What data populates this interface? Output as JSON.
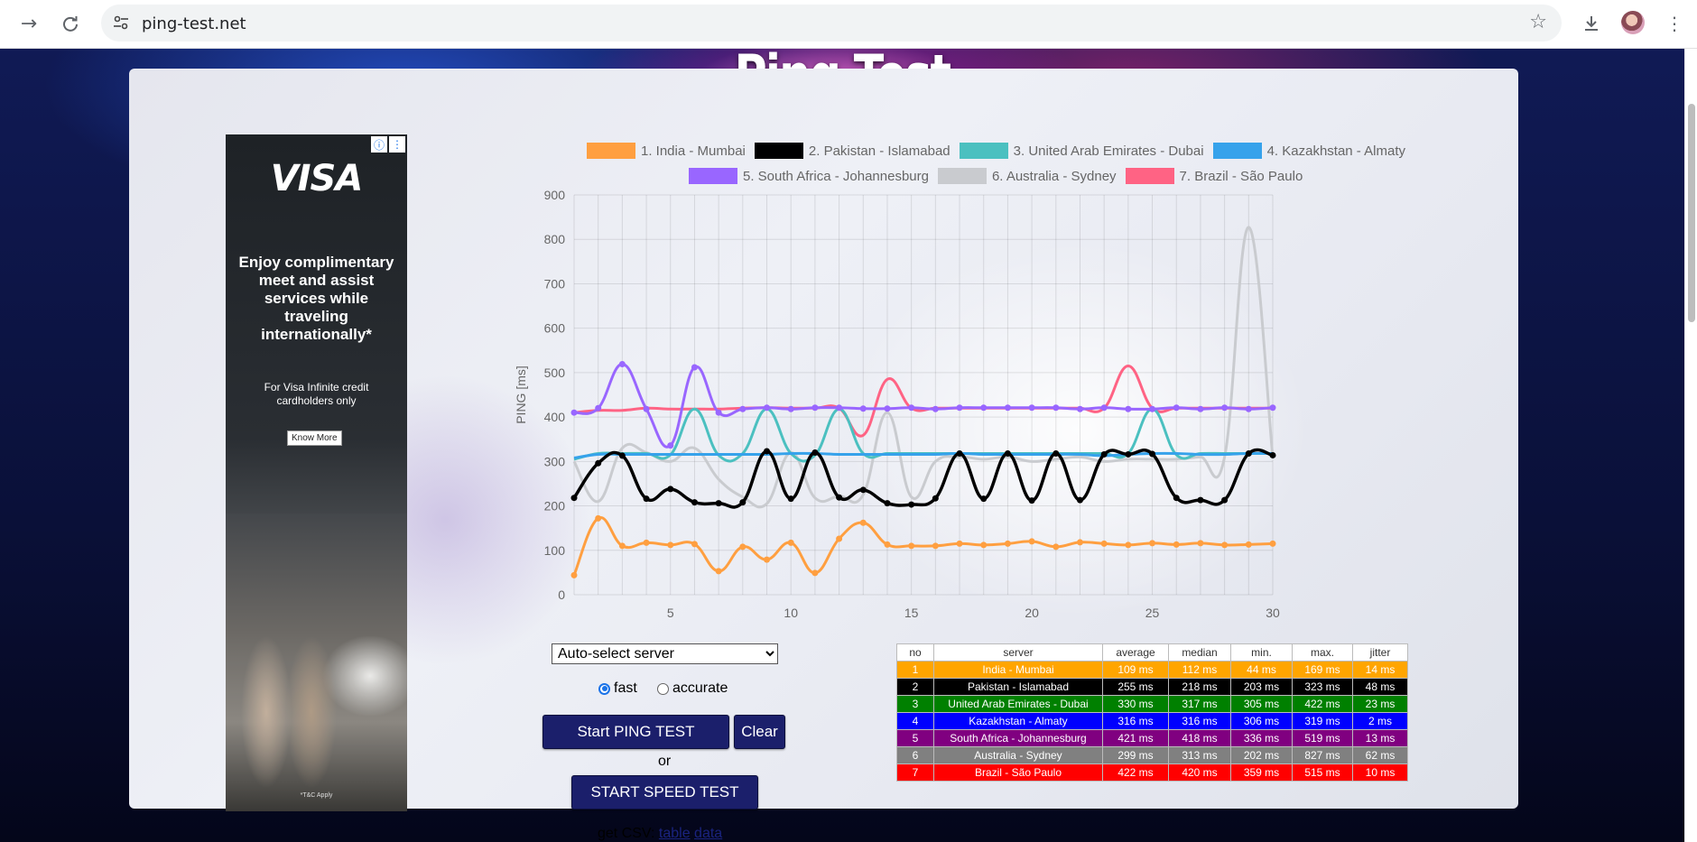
{
  "browser": {
    "url": "ping-test.net",
    "icons": [
      "forward-icon",
      "reload-icon",
      "site-settings-icon",
      "bookmark-star-icon",
      "download-icon",
      "profile-avatar",
      "menu-icon"
    ]
  },
  "page": {
    "title": "Ping Test"
  },
  "ad": {
    "brand": "VISA",
    "headline": "Enjoy complimentary meet and assist services while traveling internationally*",
    "sub": "For Visa Infinite credit cardholders only",
    "cta": "Know More",
    "fine_print": "*T&C Apply"
  },
  "chart_data": {
    "type": "line",
    "ylabel": "PING [ms]",
    "ylim": [
      0,
      900
    ],
    "yticks": [
      0,
      100,
      200,
      300,
      400,
      500,
      600,
      700,
      800,
      900
    ],
    "xlim": [
      1,
      30
    ],
    "xticks": [
      5,
      10,
      15,
      20,
      25,
      30
    ],
    "x": [
      1,
      2,
      3,
      4,
      5,
      6,
      7,
      8,
      9,
      10,
      11,
      12,
      13,
      14,
      15,
      16,
      17,
      18,
      19,
      20,
      21,
      22,
      23,
      24,
      25,
      26,
      27,
      28,
      29,
      30
    ],
    "series": [
      {
        "name": "1. India - Mumbai",
        "color": "#ff9f40",
        "points": true,
        "values": [
          44,
          172,
          110,
          117,
          112,
          114,
          53,
          108,
          79,
          117,
          49,
          126,
          162,
          113,
          110,
          110,
          115,
          112,
          115,
          120,
          108,
          118,
          115,
          112,
          116,
          113,
          116,
          112,
          113,
          115
        ]
      },
      {
        "name": "2. Pakistan - Islamabad",
        "color": "#000000",
        "points": true,
        "values": [
          218,
          296,
          313,
          216,
          238,
          208,
          206,
          208,
          323,
          216,
          320,
          219,
          236,
          206,
          203,
          217,
          318,
          216,
          318,
          212,
          318,
          213,
          316,
          316,
          317,
          218,
          213,
          213,
          318,
          314
        ]
      },
      {
        "name": "3. United Arab Emirates - Dubai",
        "color": "#4bc0c0",
        "points": false,
        "values": [
          305,
          318,
          318,
          318,
          315,
          418,
          314,
          318,
          418,
          318,
          314,
          418,
          318,
          318,
          318,
          318,
          318,
          318,
          318,
          318,
          318,
          318,
          318,
          318,
          418,
          315,
          318,
          318,
          318,
          318
        ]
      },
      {
        "name": "4. Kazakhstan - Almaty",
        "color": "#36a2eb",
        "points": false,
        "values": [
          308,
          316,
          316,
          316,
          316,
          316,
          316,
          316,
          316,
          318,
          318,
          316,
          316,
          316,
          316,
          316,
          318,
          316,
          316,
          316,
          316,
          316,
          313,
          316,
          318,
          318,
          316,
          316,
          318,
          318
        ]
      },
      {
        "name": "5. South Africa - Johannesburg",
        "color": "#9966ff",
        "points": true,
        "values": [
          410,
          420,
          519,
          418,
          336,
          512,
          410,
          418,
          421,
          418,
          421,
          421,
          419,
          419,
          421,
          418,
          421,
          421,
          421,
          421,
          421,
          418,
          421,
          418,
          418,
          421,
          418,
          421,
          418,
          421
        ]
      },
      {
        "name": "6. Australia - Sydney",
        "color": "#c9cbcf",
        "points": false,
        "values": [
          300,
          210,
          330,
          320,
          300,
          330,
          260,
          220,
          205,
          320,
          218,
          222,
          225,
          410,
          220,
          300,
          310,
          305,
          310,
          300,
          305,
          310,
          300,
          305,
          305,
          305,
          310,
          310,
          827,
          310
        ]
      },
      {
        "name": "7. Brazil - São Paulo",
        "color": "#ff6384",
        "points": false,
        "values": [
          410,
          415,
          415,
          420,
          418,
          418,
          418,
          420,
          421,
          420,
          420,
          420,
          359,
          485,
          420,
          420,
          420,
          420,
          420,
          420,
          420,
          420,
          420,
          515,
          420,
          420,
          420,
          420,
          420,
          420
        ]
      }
    ]
  },
  "controls": {
    "server_select": "Auto-select server",
    "mode_fast": "fast",
    "mode_accurate": "accurate",
    "mode_selected": "fast",
    "start_ping": "Start PING TEST",
    "clear": "Clear",
    "or": "or",
    "start_speed": "START SPEED TEST",
    "csv_label": "get CSV:",
    "csv_table": "table",
    "csv_data": "data"
  },
  "results": {
    "columns": [
      "no",
      "server",
      "average",
      "median",
      "min.",
      "max.",
      "jitter"
    ],
    "rows": [
      {
        "no": "1",
        "server": "India - Mumbai",
        "average": "109 ms",
        "median": "112 ms",
        "min": "44 ms",
        "max": "169 ms",
        "jitter": "14 ms",
        "color": "#ffa500"
      },
      {
        "no": "2",
        "server": "Pakistan - Islamabad",
        "average": "255 ms",
        "median": "218 ms",
        "min": "203 ms",
        "max": "323 ms",
        "jitter": "48 ms",
        "color": "#000000"
      },
      {
        "no": "3",
        "server": "United Arab Emirates - Dubai",
        "average": "330 ms",
        "median": "317 ms",
        "min": "305 ms",
        "max": "422 ms",
        "jitter": "23 ms",
        "color": "#008000"
      },
      {
        "no": "4",
        "server": "Kazakhstan - Almaty",
        "average": "316 ms",
        "median": "316 ms",
        "min": "306 ms",
        "max": "319 ms",
        "jitter": "2 ms",
        "color": "#0000ff"
      },
      {
        "no": "5",
        "server": "South Africa - Johannesburg",
        "average": "421 ms",
        "median": "418 ms",
        "min": "336 ms",
        "max": "519 ms",
        "jitter": "13 ms",
        "color": "#800080"
      },
      {
        "no": "6",
        "server": "Australia - Sydney",
        "average": "299 ms",
        "median": "313 ms",
        "min": "202 ms",
        "max": "827 ms",
        "jitter": "62 ms",
        "color": "#808080"
      },
      {
        "no": "7",
        "server": "Brazil - São Paulo",
        "average": "422 ms",
        "median": "420 ms",
        "min": "359 ms",
        "max": "515 ms",
        "jitter": "10 ms",
        "color": "#ff0000"
      }
    ]
  }
}
